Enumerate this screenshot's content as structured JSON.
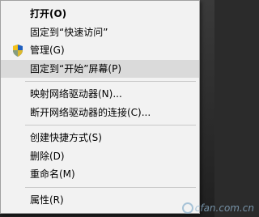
{
  "menu": {
    "items": [
      {
        "label": "打开(O)",
        "bold": true
      },
      {
        "label": "固定到“快速访问”"
      },
      {
        "label": "管理(G)",
        "icon": "shield-icon"
      },
      {
        "label": "固定到“开始”屏幕(P)",
        "hover": true
      },
      {
        "label": "映射网络驱动器(N)..."
      },
      {
        "label": "断开网络驱动器的连接(C)..."
      },
      {
        "label": "创建快捷方式(S)"
      },
      {
        "label": "删除(D)"
      },
      {
        "label": "重命名(M)"
      },
      {
        "label": "属性(R)"
      }
    ]
  },
  "watermark": {
    "text": "cfan.com.cn"
  }
}
